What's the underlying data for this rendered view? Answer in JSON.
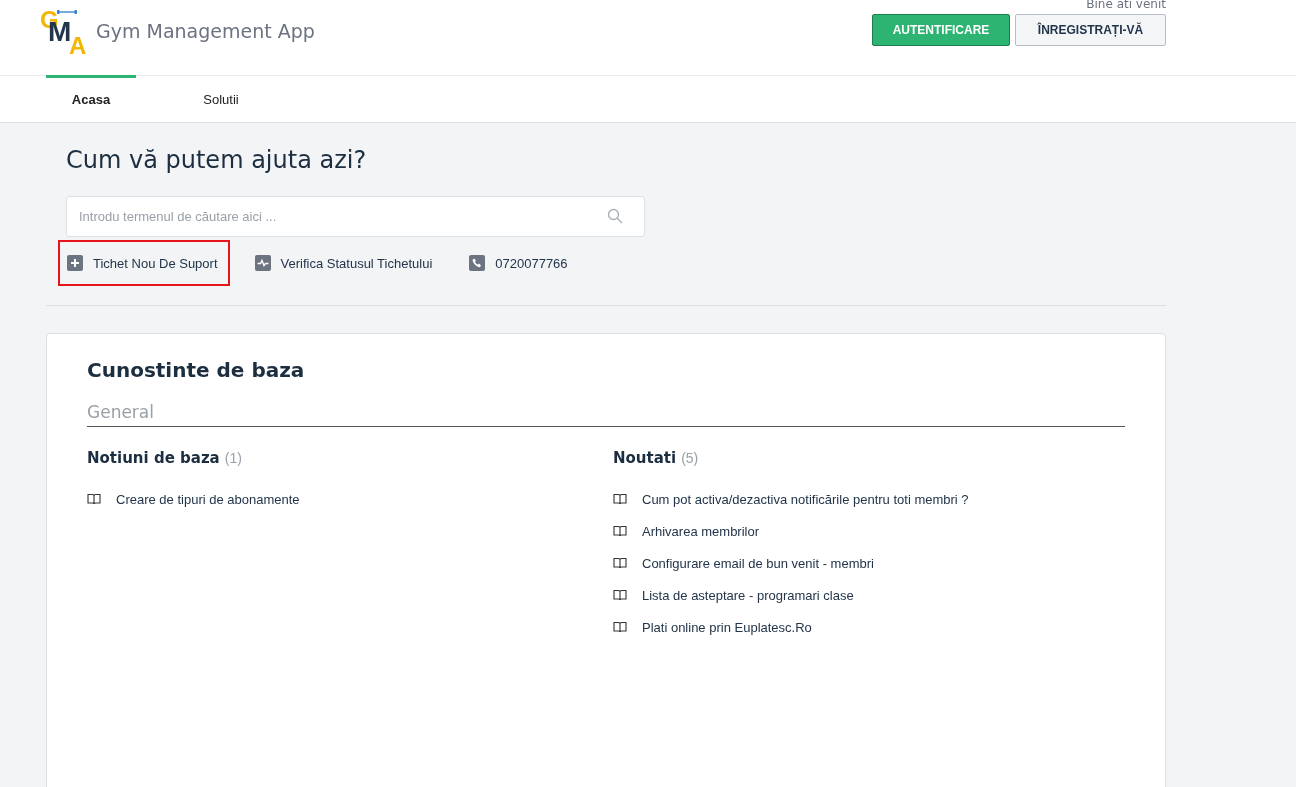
{
  "header": {
    "logo_letters": [
      "G",
      "M",
      "A"
    ],
    "app_name": "Gym Management App",
    "welcome": "Bine ati venit",
    "buttons": [
      {
        "label": "AUTENTIFICARE",
        "kind": "primary"
      },
      {
        "label": "ÎNREGISTRAȚI-VĂ",
        "kind": "secondary"
      }
    ]
  },
  "tabs": [
    {
      "label": "Acasa",
      "selected": true
    },
    {
      "label": "Solutii",
      "selected": false
    }
  ],
  "help": {
    "heading": "Cum vă putem ajuta azi?",
    "search": {
      "placeholder": "Introdu termenul de căutare aici ..."
    },
    "actions": [
      {
        "label": "Tichet Nou De Suport",
        "kind": "new-ticket",
        "highlighted": true
      },
      {
        "label": "Verifica Statusul Tichetului",
        "kind": "status",
        "highlighted": false
      },
      {
        "label": "0720077766",
        "kind": "phone",
        "highlighted": false
      }
    ]
  },
  "knowledge_base": {
    "title": "Cunostinte de baza",
    "category": "General",
    "sections": [
      {
        "title": "Notiuni de baza",
        "count": "(1)",
        "articles": [
          "Creare de tipuri de abonamente"
        ]
      },
      {
        "title": "Noutati",
        "count": "(5)",
        "articles": [
          "Cum pot activa/dezactiva notificările pentru toti membri ?",
          "Arhivarea membrilor",
          "Configurare email de bun venit - membri",
          "Lista de asteptare - programari clase",
          "Plati online prin Euplatesc.Ro"
        ]
      }
    ]
  }
}
